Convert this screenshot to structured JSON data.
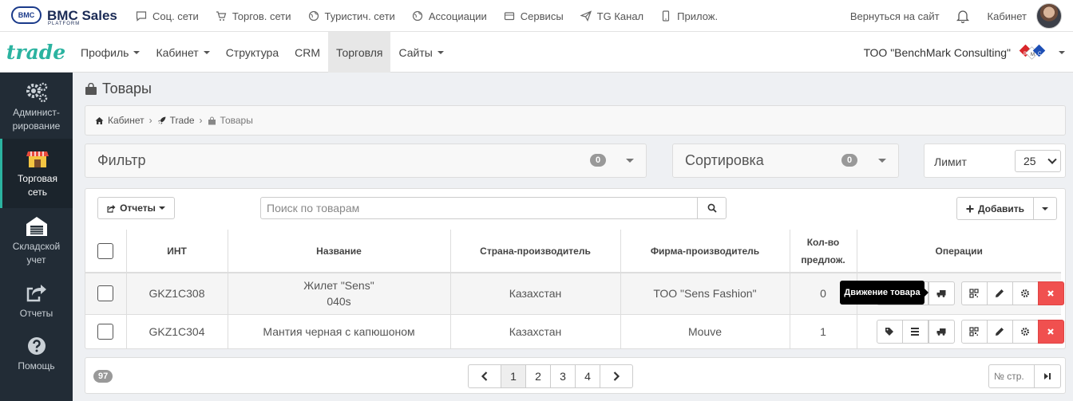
{
  "topbar": {
    "logo_mark": "BMC",
    "logo_title": "BMC Sales",
    "logo_sub": "PLATFORM",
    "nav": [
      {
        "label": "Соц. сети",
        "icon": "chat-icon"
      },
      {
        "label": "Торгов. сети",
        "icon": "cart-icon"
      },
      {
        "label": "Туристич. сети",
        "icon": "globe-icon"
      },
      {
        "label": "Ассоциации",
        "icon": "globe-icon"
      },
      {
        "label": "Сервисы",
        "icon": "box-icon"
      },
      {
        "label": "TG Канал",
        "icon": "send-icon"
      },
      {
        "label": "Прилож.",
        "icon": "phone-icon"
      }
    ],
    "back_label": "Вернуться на сайт",
    "cabinet_label": "Кабинет"
  },
  "navbar": {
    "brand": "trade",
    "items": [
      {
        "label": "Профиль",
        "caret": true
      },
      {
        "label": "Кабинет",
        "caret": true
      },
      {
        "label": "Структура",
        "caret": false
      },
      {
        "label": "CRM",
        "caret": false
      },
      {
        "label": "Торговля",
        "caret": false,
        "active": true
      },
      {
        "label": "Сайты",
        "caret": true
      }
    ],
    "company": "ТОО \"BenchMark Consulting\"",
    "company_logo_letters": [
      "B",
      "M",
      "C"
    ]
  },
  "sidebar": {
    "items": [
      {
        "label": "Админист-\nрирование",
        "icon": "gears-icon"
      },
      {
        "label": "Торговая\nсеть",
        "icon": "store-icon",
        "active": true
      },
      {
        "label": "Складской\nучет",
        "icon": "warehouse-icon"
      },
      {
        "label": "Отчеты",
        "icon": "share-icon"
      },
      {
        "label": "Помощь",
        "icon": "help-icon"
      }
    ]
  },
  "page": {
    "title": "Товары",
    "breadcrumb": [
      "Кабинет",
      "Trade",
      "Товары"
    ]
  },
  "filter": {
    "title": "Фильтр",
    "count": "0"
  },
  "sorting": {
    "title": "Сортировка",
    "count": "0"
  },
  "limit": {
    "label": "Лимит",
    "value": "25"
  },
  "toolbar": {
    "reports_label": "Отчеты",
    "search_placeholder": "Поиск по товарам",
    "add_label": "Добавить"
  },
  "table": {
    "headers": [
      "ИНТ",
      "Название",
      "Страна-производитель",
      "Фирма-производитель",
      "Кол-во\nпредлож.",
      "Операции"
    ],
    "rows": [
      {
        "int": "GKZ1C308",
        "name": "Жилет \"Sens\"\n040s",
        "country": "Казахстан",
        "firm": "ТОО \"Sens Fashion\"",
        "qty": "0"
      },
      {
        "int": "GKZ1C304",
        "name": "Мантия черная с капюшоном",
        "country": "Казахстан",
        "firm": "Mouve",
        "qty": "1"
      }
    ]
  },
  "tooltip": "Движение товара",
  "footer": {
    "total": "97",
    "pages": [
      "1",
      "2",
      "3",
      "4"
    ],
    "current_page": "1",
    "page_input_placeholder": "№ стр."
  },
  "colors": {
    "accent": "#2bb3a0",
    "sidebar_bg": "#222c36",
    "danger": "#f0504f"
  }
}
